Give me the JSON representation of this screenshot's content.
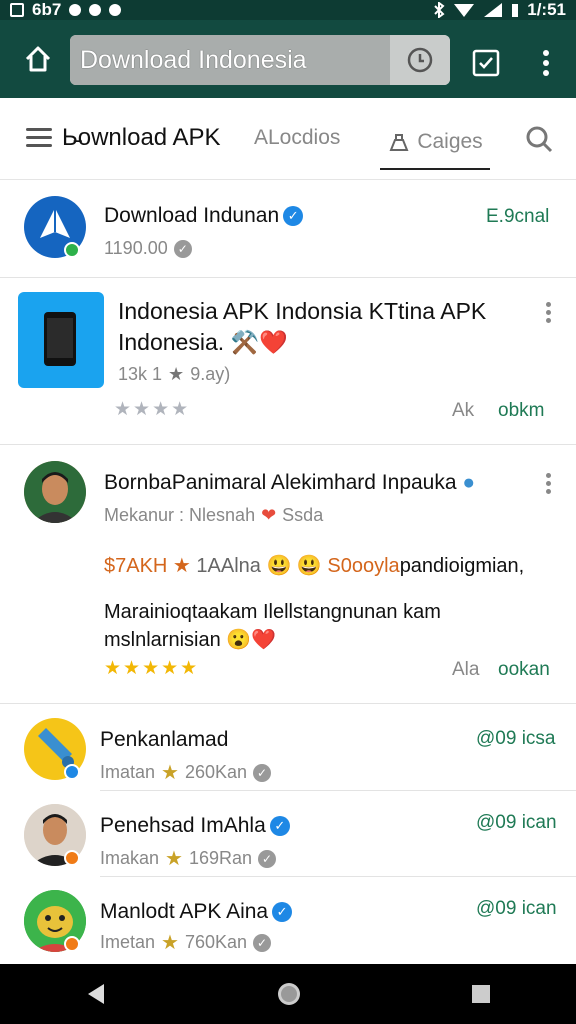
{
  "status_bar": {
    "left_text": "6b7",
    "time": "1/:51"
  },
  "browser": {
    "url_text": "Download Indonesia"
  },
  "nav": {
    "title": "Ь̵ownload APK",
    "tab_1": "ALocdios",
    "tab_2": "Caiges"
  },
  "items": [
    {
      "name": "Download Indunan",
      "sub": "1190.00",
      "right": "E.9cnal"
    },
    {
      "title": "Indonesia APK Indonsia KTtina APK Indonesia.",
      "emoji": "⚒️❤️",
      "meta_count": "13k 1",
      "meta_rating": "9.ay)",
      "stars": "★★★★",
      "action_gray": "Ak",
      "action_green": "obkm"
    },
    {
      "name": "BornbaPanimaral Alekimhard Inpauka",
      "sub_prefix": "Mekanur : Nlesnah",
      "sub_suffix": "Ssda",
      "line1_orange": "$7AKH ★",
      "line1_mid": "1AAlna 😃 😃",
      "line1_orange2": "S0ooyla",
      "line1_end": "pandioigmian,",
      "line2": "Marainioqtaakam Ilellstangnunan kam",
      "line3": "mslnlarnisian 😮❤️",
      "stars": "★★★★★",
      "action_gray": "Ala",
      "action_green": "ookan"
    },
    {
      "name": "Penkanlamad",
      "sub_prefix": "Imatan",
      "sub_value": "260Kan",
      "right": "@09 icsa"
    },
    {
      "name": "Penehsad ImAhla",
      "sub_prefix": "Imakan",
      "sub_value": "169Ran",
      "right": "@09 ican"
    },
    {
      "name": "Manlodt APK Aina",
      "sub_prefix": "Imetan",
      "sub_value": "760Kan",
      "right": "@09 ican"
    }
  ],
  "colors": {
    "toolbar": "#124a40",
    "status": "#0d3b33",
    "accent_green": "#1f7a55",
    "verified_blue": "#1e88e5"
  }
}
